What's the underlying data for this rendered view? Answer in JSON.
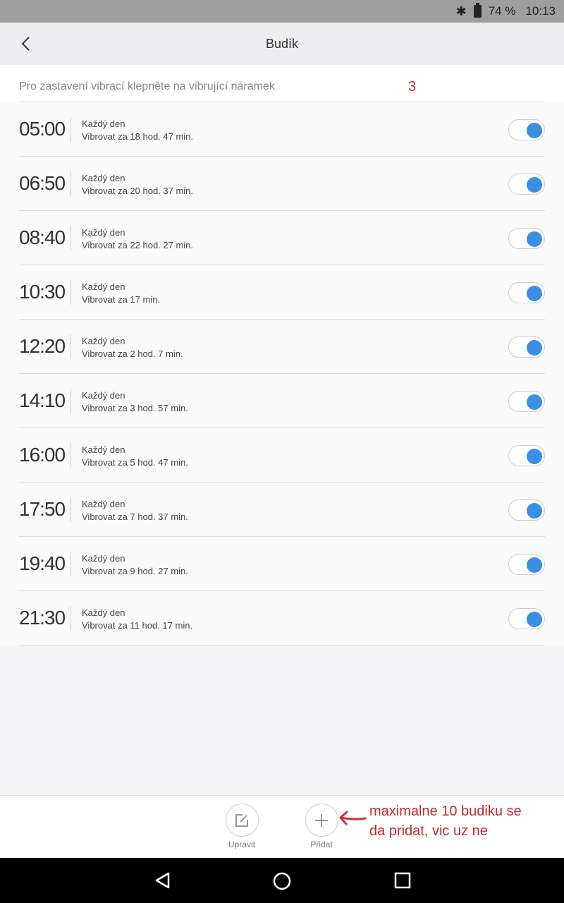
{
  "status_bar": {
    "battery": "74 %",
    "time": "10:13",
    "icons": [
      "bluetooth-icon",
      "battery-icon"
    ]
  },
  "app_bar": {
    "title": "Budík",
    "back_icon": "chevron-left-icon"
  },
  "hint": {
    "text": "Pro zastavení vibrací klepněte na vibrující náramek",
    "note": "3"
  },
  "alarms": [
    {
      "time": "05:00",
      "repeat": "Každý den",
      "countdown": "Vibrovat za 18  hod. 47  min.",
      "enabled": true
    },
    {
      "time": "06:50",
      "repeat": "Každý den",
      "countdown": "Vibrovat za 20  hod. 37  min.",
      "enabled": true
    },
    {
      "time": "08:40",
      "repeat": "Každý den",
      "countdown": "Vibrovat za 22  hod. 27  min.",
      "enabled": true
    },
    {
      "time": "10:30",
      "repeat": "Každý den",
      "countdown": "Vibrovat za 17  min.",
      "enabled": true
    },
    {
      "time": "12:20",
      "repeat": "Každý den",
      "countdown": "Vibrovat za 2  hod. 7  min.",
      "enabled": true
    },
    {
      "time": "14:10",
      "repeat": "Každý den",
      "countdown": "Vibrovat za 3  hod. 57  min.",
      "enabled": true
    },
    {
      "time": "16:00",
      "repeat": "Každý den",
      "countdown": "Vibrovat za 5  hod. 47  min.",
      "enabled": true
    },
    {
      "time": "17:50",
      "repeat": "Každý den",
      "countdown": "Vibrovat za 7  hod. 37  min.",
      "enabled": true
    },
    {
      "time": "19:40",
      "repeat": "Každý den",
      "countdown": "Vibrovat za 9  hod. 27  min.",
      "enabled": true
    },
    {
      "time": "21:30",
      "repeat": "Každý den",
      "countdown": "Vibrovat za 11  hod. 17  min.",
      "enabled": true
    }
  ],
  "bottom_bar": {
    "edit_label": "Upravit",
    "add_label": "Přidat",
    "annotation": "maximalne 10 budiku se\nda pridat, vic uz ne"
  },
  "colors": {
    "accent": "#3a8ee6",
    "annotation": "#c62828",
    "status_bar": "#9e9e9e"
  }
}
